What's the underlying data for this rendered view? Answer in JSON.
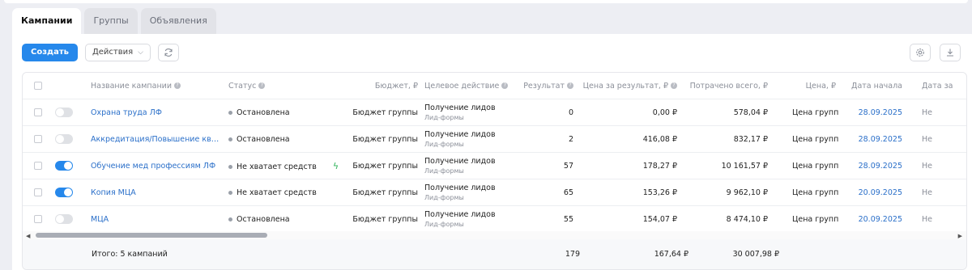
{
  "tabs": [
    "Кампании",
    "Группы",
    "Объявления"
  ],
  "toolbar": {
    "create_label": "Создать",
    "actions_label": "Действия"
  },
  "columns": {
    "name": "Название кампании",
    "status": "Статус",
    "budget": "Бюджет, ₽",
    "target": "Целевое действие",
    "result": "Результат",
    "cost_per_result": "Цена за результат, ₽",
    "spent": "Потрачено всего, ₽",
    "price": "Цена, ₽",
    "start_date": "Дата начала",
    "end_date": "Дата за"
  },
  "rows": [
    {
      "toggle": false,
      "name": "Охрана труда ЛФ",
      "status": "Остановлена",
      "bolt": false,
      "budget": "Бюджет группы",
      "target": "Получение лидов",
      "target_sub": "Лид-формы",
      "result": "0",
      "cost_per_result": "0,00 ₽",
      "spent": "578,04 ₽",
      "price": "Цена группы",
      "start_date": "28.09.2025",
      "end_date": "Не"
    },
    {
      "toggle": false,
      "name": "Аккредитация/Повышение квали...",
      "status": "Остановлена",
      "bolt": false,
      "budget": "Бюджет группы",
      "target": "Получение лидов",
      "target_sub": "Лид-формы",
      "result": "2",
      "cost_per_result": "416,08 ₽",
      "spent": "832,17 ₽",
      "price": "Цена группы",
      "start_date": "28.09.2025",
      "end_date": "Не"
    },
    {
      "toggle": true,
      "name": "Обучение мед профессиям ЛФ",
      "status": "Не хватает средств",
      "bolt": true,
      "budget": "Бюджет группы",
      "target": "Получение лидов",
      "target_sub": "Лид-формы",
      "result": "57",
      "cost_per_result": "178,27 ₽",
      "spent": "10 161,57 ₽",
      "price": "Цена группы",
      "start_date": "28.09.2025",
      "end_date": "Не"
    },
    {
      "toggle": true,
      "name": "Копия МЦА",
      "status": "Не хватает средств",
      "bolt": false,
      "budget": "Бюджет группы",
      "target": "Получение лидов",
      "target_sub": "Лид-формы",
      "result": "65",
      "cost_per_result": "153,26 ₽",
      "spent": "9 962,10 ₽",
      "price": "Цена группы",
      "start_date": "20.09.2025",
      "end_date": "Не"
    },
    {
      "toggle": false,
      "name": "МЦА",
      "status": "Остановлена",
      "bolt": false,
      "budget": "Бюджет группы",
      "target": "Получение лидов",
      "target_sub": "Лид-формы",
      "result": "55",
      "cost_per_result": "154,07 ₽",
      "spent": "8 474,10 ₽",
      "price": "Цена группы",
      "start_date": "20.09.2025",
      "end_date": "Не"
    }
  ],
  "totals": {
    "label": "Итого: 5 кампаний",
    "result": "179",
    "cost_per_result": "167,64 ₽",
    "spent": "30 007,98 ₽"
  },
  "colors": {
    "accent": "#2688eb",
    "link": "#2a6fc9",
    "success": "#2fb35a"
  },
  "icons": [
    "refresh-icon",
    "settings-icon",
    "download-icon",
    "help-icon",
    "lightning-icon"
  ]
}
